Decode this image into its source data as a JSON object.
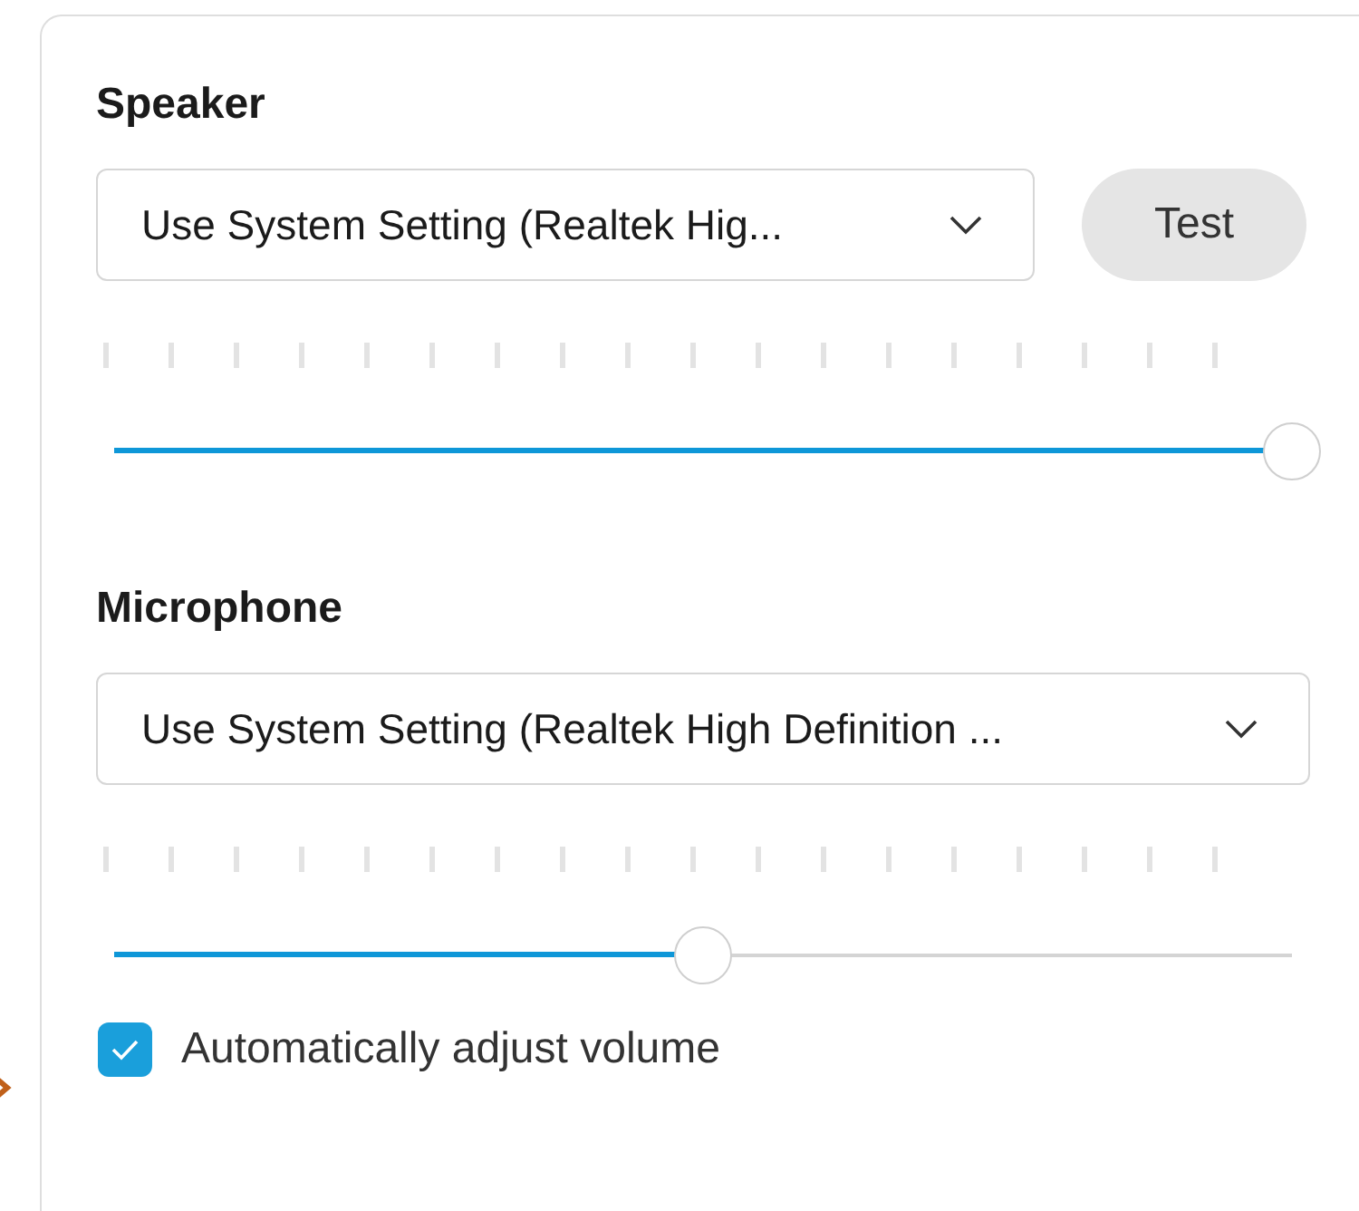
{
  "sections": [
    {
      "title": "Speaker",
      "device": {
        "value": "Use System Setting (Realtek Hig..."
      },
      "test_button": "Test",
      "volume": {
        "level": 1.0
      }
    },
    {
      "title": "Microphone",
      "device": {
        "value": "Use System Setting (Realtek High Definition ..."
      },
      "volume": {
        "level": 0.5
      }
    }
  ],
  "auto_adjust": {
    "label": "Automatically adjust volume",
    "checked": true
  }
}
